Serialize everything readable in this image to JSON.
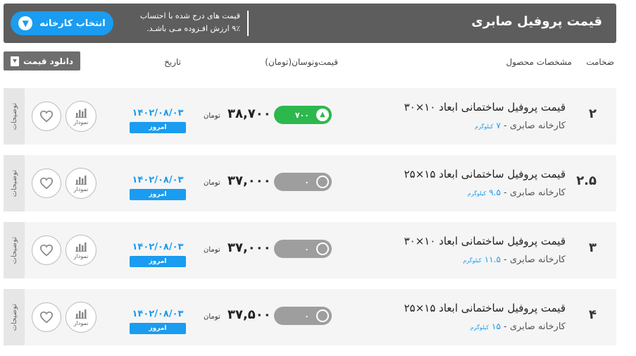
{
  "header": {
    "title": "قیمت پروفیل صابری",
    "note_line1": "قیمت های درج شده با احتساب",
    "note_line2": "۹٪ ارزش افـزوده مـی باشـد.",
    "choose_factory_label": "انتخاب کارخانه",
    "choose_factory_icon": "chevron-down-icon"
  },
  "columns": {
    "thickness": "ضخامت",
    "specs": "مشخصات محصول",
    "price": "قیمت‌ونوسان(تومان)",
    "date": "تاریخ"
  },
  "download_label": "دانلود قیمت",
  "colors": {
    "header_bg": "#5d5d5d",
    "accent": "#1a9cf0",
    "up": "#2db84d",
    "neutral": "#9e9e9e"
  },
  "rows": [
    {
      "thickness": "۲",
      "name": "قیمت پروفیل ساختمانی ابعاد ۱۰×۳۰",
      "factory": "کارخانه صابری - ",
      "weight": "۷",
      "weight_unit": "کیلوگرم",
      "change": "۷۰۰",
      "change_dir": "up",
      "price": "۳۸,۷۰۰",
      "unit": "تومان",
      "date": "۱۴۰۲/۰۸/۰۳",
      "today": "امروز",
      "chart_label": "نمودار",
      "notes_label": "توضیحات"
    },
    {
      "thickness": "۲.۵",
      "name": "قیمت پروفیل ساختمانی ابعاد ۱۵×۲۵",
      "factory": "کارخانه صابری - ",
      "weight": "۹.۵",
      "weight_unit": "کیلوگرم",
      "change": "۰",
      "change_dir": "none",
      "price": "۳۷,۰۰۰",
      "unit": "تومان",
      "date": "۱۴۰۲/۰۸/۰۳",
      "today": "امروز",
      "chart_label": "نمودار",
      "notes_label": "توضیحات"
    },
    {
      "thickness": "۳",
      "name": "قیمت پروفیل ساختمانی ابعاد ۱۰×۳۰",
      "factory": "کارخانه صابری - ",
      "weight": "۱۱.۵",
      "weight_unit": "کیلوگرم",
      "change": "۰",
      "change_dir": "none",
      "price": "۳۷,۰۰۰",
      "unit": "تومان",
      "date": "۱۴۰۲/۰۸/۰۳",
      "today": "امروز",
      "chart_label": "نمودار",
      "notes_label": "توضیحات"
    },
    {
      "thickness": "۴",
      "name": "قیمت پروفیل ساختمانی ابعاد ۱۵×۲۵",
      "factory": "کارخانه صابری - ",
      "weight": "۱۵",
      "weight_unit": "کیلوگرم",
      "change": "۰",
      "change_dir": "none",
      "price": "۳۷,۵۰۰",
      "unit": "تومان",
      "date": "۱۴۰۲/۰۸/۰۳",
      "today": "امروز",
      "chart_label": "نمودار",
      "notes_label": "توضیحات"
    }
  ]
}
